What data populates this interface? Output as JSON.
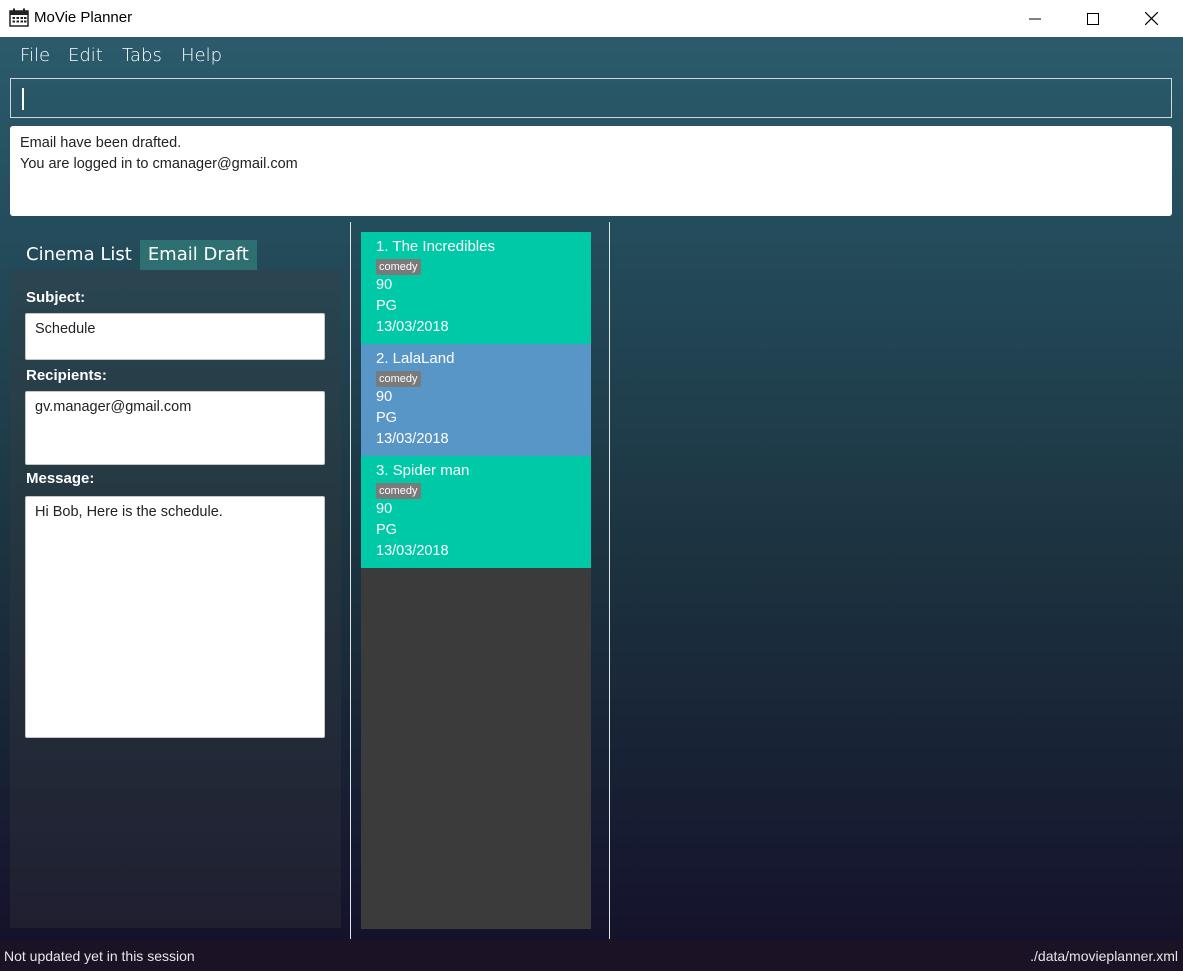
{
  "window": {
    "title": "MoVie Planner"
  },
  "menu": {
    "items": [
      "File",
      "Edit",
      "Tabs",
      "Help"
    ]
  },
  "command": {
    "value": ""
  },
  "result": {
    "line1": "Email have been drafted.",
    "line2": "You are logged in to cmanager@gmail.com"
  },
  "tabs": {
    "items": [
      "Cinema List",
      "Email Draft"
    ],
    "active": "Email Draft"
  },
  "email": {
    "subject_label": "Subject:",
    "subject": "Schedule",
    "recipients_label": "Recipients:",
    "recipients": "gv.manager@gmail.com",
    "message_label": "Message:",
    "message": "Hi Bob, Here is the schedule."
  },
  "movies": [
    {
      "title": "1.  The Incredibles",
      "tag": "comedy",
      "duration": "90",
      "rating": "PG",
      "date": "13/03/2018",
      "color": "#00c9a7"
    },
    {
      "title": "2.  LalaLand",
      "tag": "comedy",
      "duration": "90",
      "rating": "PG",
      "date": "13/03/2018",
      "color": "#5896c8"
    },
    {
      "title": "3.  Spider man",
      "tag": "comedy",
      "duration": "90",
      "rating": "PG",
      "date": "13/03/2018",
      "color": "#00c9a7"
    }
  ],
  "status": {
    "left": "Not updated yet in this session",
    "right": "./data/movieplanner.xml"
  }
}
